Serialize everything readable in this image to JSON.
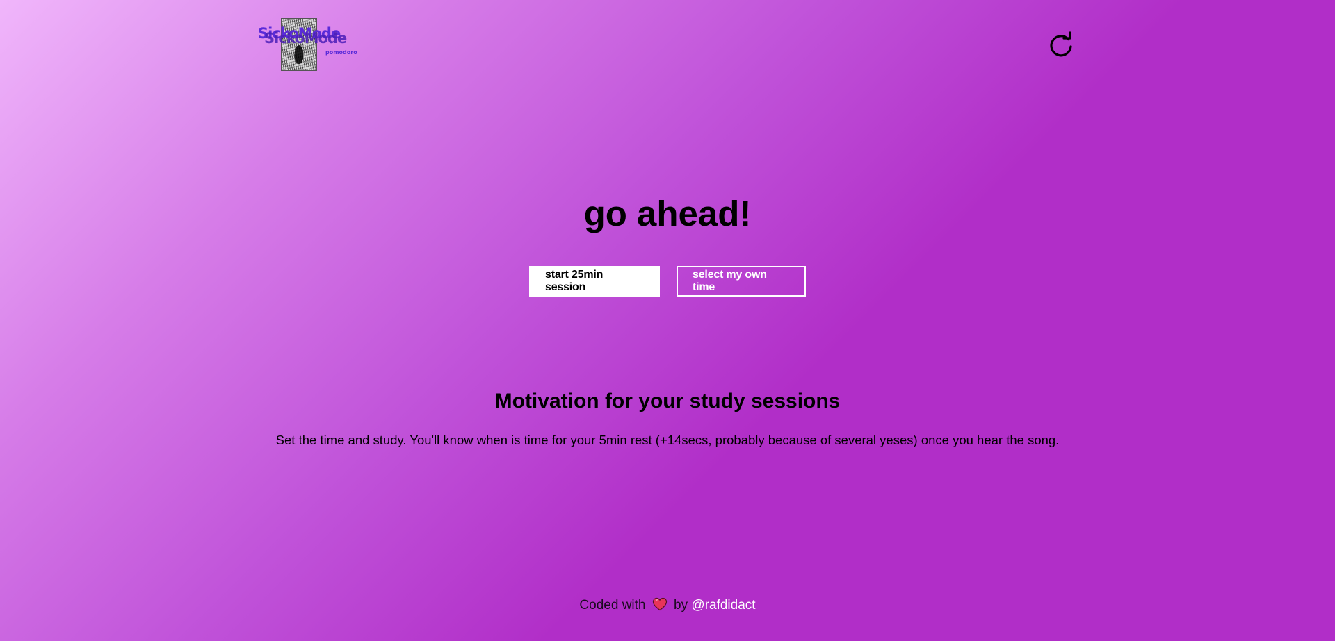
{
  "header": {
    "logo": {
      "title": "SickoMode",
      "subtitle": "pomodoro",
      "image_icon": "scream-painting-icon"
    },
    "refresh_icon": "refresh-icon"
  },
  "hero": {
    "title": "go ahead!",
    "start_button_label": "start 25min session",
    "custom_time_button_label": "select my own time"
  },
  "motivation": {
    "title": "Motivation for your study sessions",
    "text": "Set the time and study. You'll know when is time for your 5min rest (+14secs, probably because of several yeses) once you hear the song."
  },
  "footer": {
    "prefix": "Coded with",
    "heart_icon": "heart-icon",
    "by_label": "by",
    "author_link": "@rafdidact"
  },
  "colors": {
    "background_start": "#f0b6fb",
    "background_end": "#b12ec8",
    "logo_text": "#5a2bd9",
    "button_primary_bg": "#ffffff",
    "button_outline_border": "#ffffff",
    "link": "#ffffff"
  }
}
